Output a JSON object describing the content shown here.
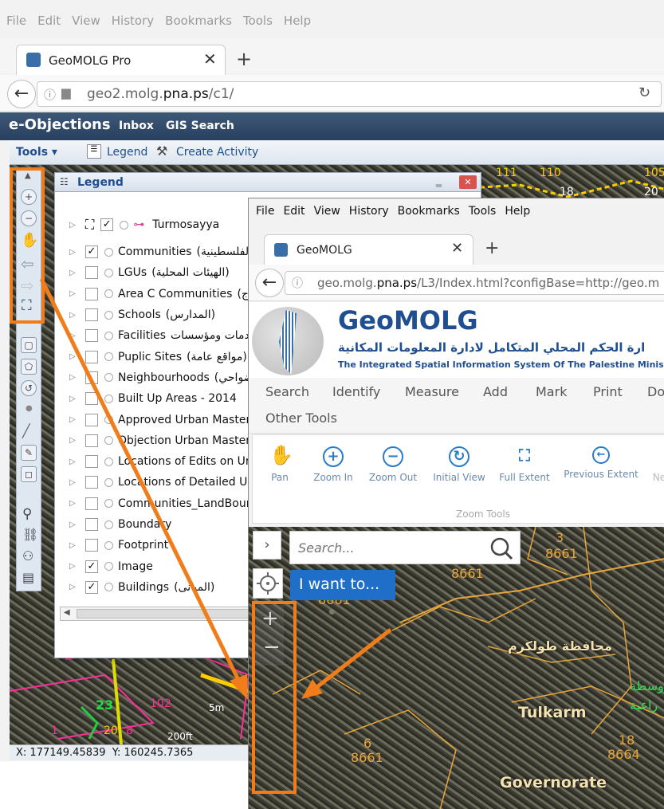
{
  "win1": {
    "menu": [
      "File",
      "Edit",
      "View",
      "History",
      "Bookmarks",
      "Tools",
      "Help"
    ],
    "tab_title": "GeoMOLG Pro",
    "url_prefix": "geo2.molg.",
    "url_domain": "pna.ps",
    "url_suffix": "/c1/",
    "app_title": "e-Objections",
    "nav": [
      "Inbox",
      "GIS Search"
    ],
    "toolbar": {
      "tools": "Tools",
      "legend": "Legend",
      "create": "Create Activity"
    },
    "legend": {
      "title": "Legend",
      "top_item": "Turmosayya",
      "items": [
        {
          "label": "Communities",
          "ar": "(ت الفلسطينية",
          "checked": true
        },
        {
          "label": "LGUs",
          "ar": "(الهيئات المحلية)",
          "checked": false
        },
        {
          "label": "Area C Communities",
          "ar": "(ج",
          "checked": false
        },
        {
          "label": "Schools",
          "ar": "(المدارس)",
          "checked": false
        },
        {
          "label": "Facilities",
          "ar": "وخدمات ومؤسسات)",
          "checked": false
        },
        {
          "label": "Puplic Sites",
          "ar": "(مواقع عامة)",
          "checked": false
        },
        {
          "label": "Neighbourhoods",
          "ar": "(ضواحي",
          "checked": false
        },
        {
          "label": "Built Up Areas - 2014",
          "ar": "",
          "checked": false
        },
        {
          "label": "Approved Urban Master",
          "ar": "",
          "checked": false
        },
        {
          "label": "Objection Urban Master",
          "ar": "",
          "checked": false
        },
        {
          "label": "Locations of Edits on Ur",
          "ar": "",
          "checked": false
        },
        {
          "label": "Locations of Detailed U",
          "ar": "",
          "checked": false
        },
        {
          "label": "Communities_LandBour",
          "ar": "",
          "checked": false
        },
        {
          "label": "Boundary",
          "ar": "",
          "checked": false
        },
        {
          "label": "Footprint",
          "ar": "",
          "checked": false
        },
        {
          "label": "Image",
          "ar": "",
          "checked": true
        },
        {
          "label": "Buildings",
          "ar": "(المبانى)",
          "checked": true
        }
      ]
    },
    "map_labels": [
      "111",
      "110",
      "18",
      "105",
      "20",
      "23",
      "102",
      "20",
      "1",
      "8",
      "5m",
      "200ft"
    ],
    "coords": "X: 177149.45839  Y: 160245.7365"
  },
  "win2": {
    "menu": [
      "File",
      "Edit",
      "View",
      "History",
      "Bookmarks",
      "Tools",
      "Help"
    ],
    "tab_title": "GeoMOLG",
    "url_prefix": "geo.molg.",
    "url_domain": "pna.ps",
    "url_suffix": "/L3/Index.html?configBase=http://geo.m",
    "logo_title": "GeoMOLG",
    "logo_ar": "ارة الحكم المحلي المتكامل لادارة المعلومات المكانية",
    "logo_en": "The Integrated Spatial Information System Of The Palestine Ministry O",
    "nav": [
      "Search",
      "Identify",
      "Measure",
      "Add",
      "Mark",
      "Print",
      "Do"
    ],
    "nav2": "Other Tools",
    "tools": [
      {
        "label": "Pan",
        "icon": "hand-icon"
      },
      {
        "label": "Zoom In",
        "icon": "plus-icon"
      },
      {
        "label": "Zoom Out",
        "icon": "minus-icon"
      },
      {
        "label": "Initial View",
        "icon": "refresh-icon"
      },
      {
        "label": "Full Extent",
        "icon": "expand-icon"
      },
      {
        "label": "Previous Extent",
        "icon": "back-icon"
      },
      {
        "label": "Ne",
        "icon": "forward-icon"
      }
    ],
    "group_label": "Zoom Tools",
    "search_placeholder": "Search...",
    "iwant": "I want to...",
    "map_labels": [
      "3",
      "8661",
      "8661",
      "8661",
      "محافظة طولكرم",
      "Tulkarm",
      "6",
      "8661",
      "18",
      "8664",
      "Governorate",
      "وسطة",
      "راعية"
    ]
  },
  "colors": {
    "orange": "#f07d1a",
    "accent_blue": "#1f5fa8",
    "title_blue": "#1f4e91"
  }
}
